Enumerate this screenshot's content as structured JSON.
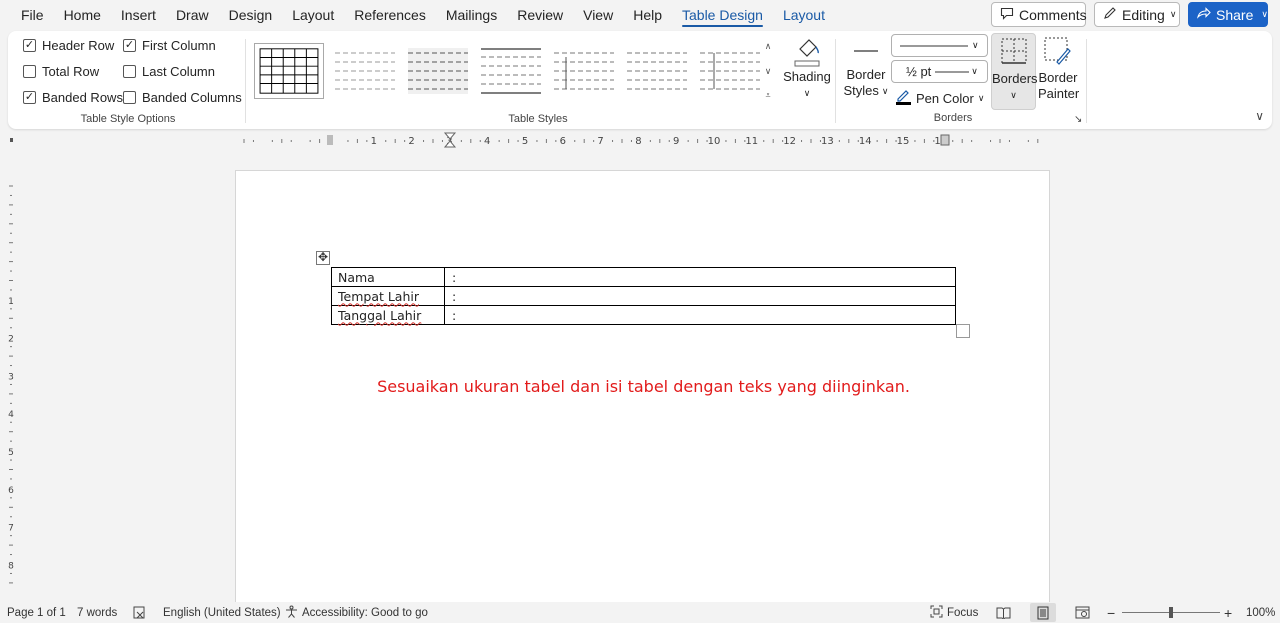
{
  "menu": {
    "tabs": [
      "File",
      "Home",
      "Insert",
      "Draw",
      "Design",
      "Layout",
      "References",
      "Mailings",
      "Review",
      "View",
      "Help"
    ],
    "context_tabs": [
      "Table Design",
      "Layout"
    ],
    "active_tab": "Table Design"
  },
  "top_buttons": {
    "comments": "Comments",
    "editing": "Editing",
    "share": "Share"
  },
  "ribbon": {
    "table_style_options": {
      "title": "Table Style Options",
      "header_row": {
        "label": "Header Row",
        "checked": true
      },
      "first_column": {
        "label": "First Column",
        "checked": true
      },
      "total_row": {
        "label": "Total Row",
        "checked": false
      },
      "last_column": {
        "label": "Last Column",
        "checked": false
      },
      "banded_rows": {
        "label": "Banded Rows",
        "checked": true
      },
      "banded_columns": {
        "label": "Banded Columns",
        "checked": false
      }
    },
    "table_styles": {
      "title": "Table Styles",
      "shading": "Shading"
    },
    "borders": {
      "title": "Borders",
      "border_styles_line1": "Border",
      "border_styles_line2": "Styles",
      "weight": "½ pt",
      "pen_color": "Pen Color",
      "borders_btn": "Borders",
      "border_painter_line1": "Border",
      "border_painter_line2": "Painter",
      "pen_color_hex": "#000000"
    }
  },
  "ruler": {
    "h_numbers": [
      "1",
      "2",
      "3",
      "4",
      "5",
      "6",
      "7",
      "8",
      "9",
      "10",
      "11",
      "12",
      "13",
      "14",
      "15",
      "16"
    ],
    "v_numbers": [
      "1",
      "2",
      "3",
      "4",
      "5",
      "6",
      "7",
      "8"
    ]
  },
  "document": {
    "table": [
      {
        "label": "Nama",
        "value": ":"
      },
      {
        "label": "Tempat Lahir",
        "value": ":"
      },
      {
        "label": "Tanggal Lahir",
        "value": ":"
      }
    ],
    "instruction": "Sesuaikan ukuran tabel dan isi tabel dengan teks yang diinginkan.",
    "instruction_color": "#e21b1b"
  },
  "status": {
    "page": "Page 1 of 1",
    "words": "7 words",
    "language": "English (United States)",
    "accessibility": "Accessibility: Good to go",
    "focus": "Focus",
    "zoom": "100%",
    "zoom_percent": 100
  },
  "colors": {
    "accent": "#1a5aa6",
    "share_bg": "#1c63c7",
    "app_bg": "#f3f3f3"
  }
}
